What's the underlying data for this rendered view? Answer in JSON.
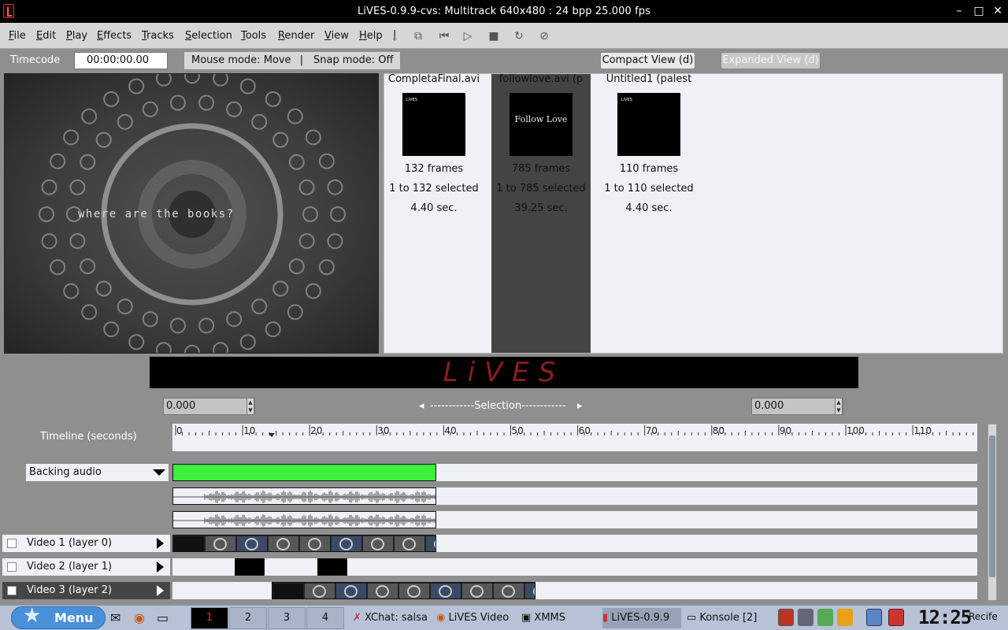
{
  "window": {
    "title": "LiVES-0.9.9-cvs: Multitrack 640x480 : 24 bpp 25.000 fps",
    "min": "–",
    "max": "□",
    "close": "✕"
  },
  "menu": [
    "File",
    "Edit",
    "Play",
    "Effects",
    "Tracks",
    "Selection",
    "Tools",
    "Render",
    "View",
    "Help"
  ],
  "toolbar": {
    "sep": "|",
    "icons": [
      "clip-editor-icon",
      "rewind-icon",
      "play-icon",
      "stop-icon",
      "loop-icon",
      "mute-icon"
    ]
  },
  "timecode": {
    "label": "Timecode",
    "value": "00:00:00.00"
  },
  "modes": {
    "mouse": "Mouse mode: Move",
    "sep": "|",
    "snap": "Snap mode: Off"
  },
  "views": {
    "compact": "Compact View (d)",
    "expanded": "Expanded View (d)"
  },
  "preview": {
    "text": "where are the books?"
  },
  "clips": [
    {
      "name": "CompletaFinal.avi",
      "frames": "132 frames",
      "selected": "1 to 132 selected",
      "duration": "4.40 sec.",
      "thumb_logo": "LiVES",
      "thumb_text": ""
    },
    {
      "name": "followlove.avi (p",
      "frames": "785 frames",
      "selected": "1 to 785 selected",
      "duration": "39.25 sec.",
      "thumb_logo": "",
      "thumb_text": "Follow Love"
    },
    {
      "name": "Untitled1 (palest",
      "frames": "110 frames",
      "selected": "1 to 110 selected",
      "duration": "4.40 sec.",
      "thumb_logo": "LiVES",
      "thumb_text": ""
    }
  ],
  "logo": "LiVES",
  "selection": {
    "start": "0.000",
    "end": "0.000",
    "label": "------------Selection------------",
    "left_arrow": "◂",
    "right_arrow": "▸"
  },
  "timeline": {
    "label": "Timeline (seconds)",
    "ticks": [
      "0",
      "10",
      "20",
      "30",
      "40",
      "50",
      "60",
      "70",
      "80",
      "90",
      "100",
      "110"
    ]
  },
  "tracks": {
    "backing_audio": "Backing audio",
    "video": [
      {
        "label": "Video 1 (layer 0)",
        "active": false
      },
      {
        "label": "Video 2 (layer 1)",
        "active": false
      },
      {
        "label": "Video 3 (layer 2)",
        "active": true
      }
    ]
  },
  "taskbar": {
    "menu": "Menu",
    "desktops": [
      "1",
      "2",
      "3",
      "4"
    ],
    "tasks": [
      "XChat: salsa",
      "LiVES Video",
      "XMMS",
      "LiVES-0.9.9",
      "Konsole [2]"
    ],
    "clock": "12:25",
    "location": "Recife",
    "colors": {
      "panel": "#b8c2d6",
      "menu_button": "#4a90d9"
    }
  },
  "colors": {
    "audio_track": "#3cf23c",
    "selected_clip": "#444444",
    "logo": "#8b1d1d"
  }
}
